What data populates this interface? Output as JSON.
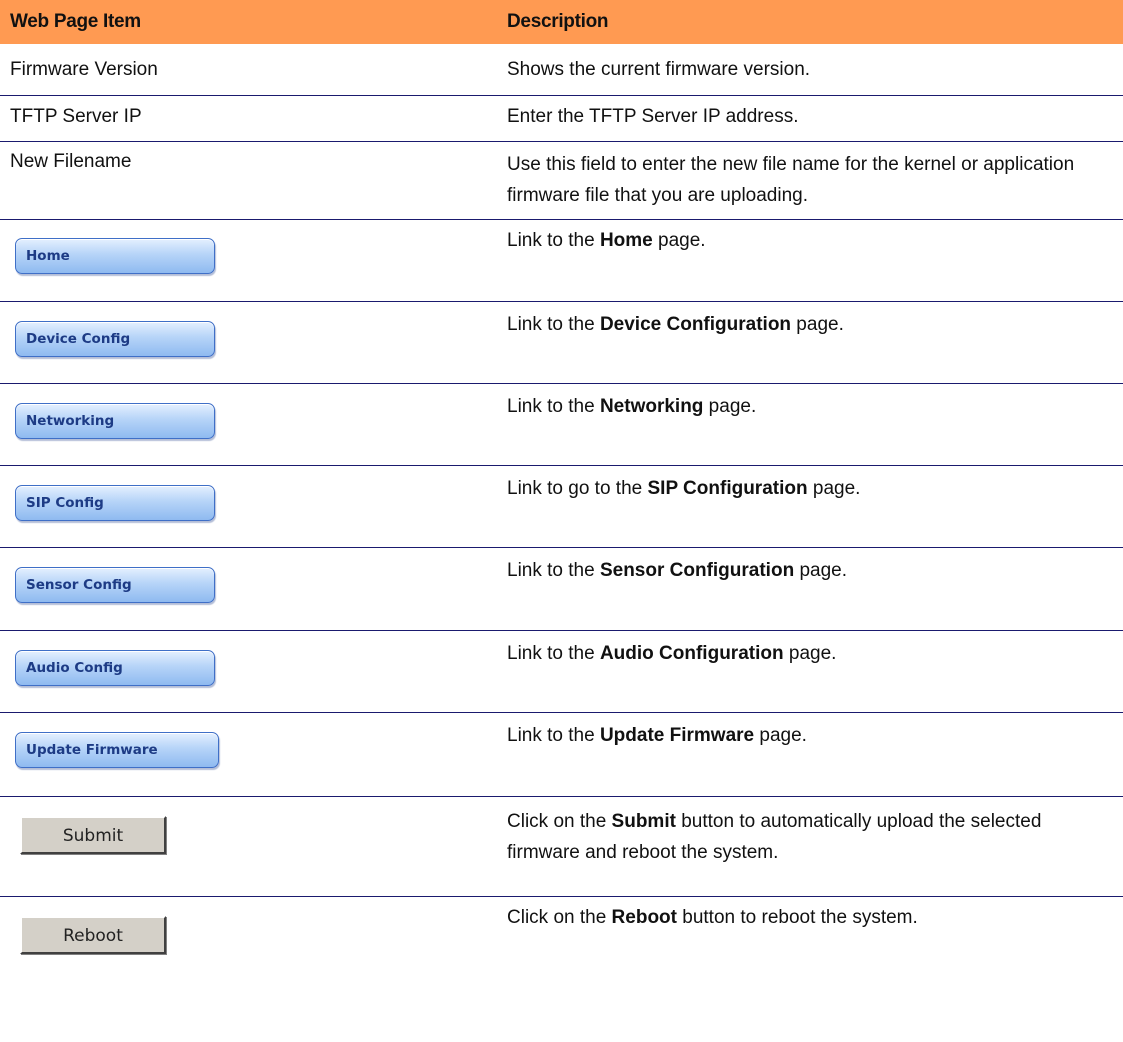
{
  "table": {
    "headers": [
      "Web Page Item",
      "Description"
    ],
    "rows": [
      {
        "item": "Firmware Version",
        "description": "Shows the current firmware version."
      },
      {
        "item": "TFTP Server IP",
        "description": "Enter the TFTP Server IP address."
      },
      {
        "item": "New Filename",
        "description": "Use this field to enter the new file name for the kernel or application firmware file that you are uploading."
      },
      {
        "item_button": "Home",
        "desc_pre": "Link to the ",
        "desc_bold": "Home",
        "desc_post": " page."
      },
      {
        "item_button": "Device Config",
        "desc_pre": "Link to the ",
        "desc_bold": "Device Configuration",
        "desc_post": " page."
      },
      {
        "item_button": "Networking",
        "desc_pre": "Link to the ",
        "desc_bold": "Networking",
        "desc_post": " page."
      },
      {
        "item_button": "SIP Config",
        "desc_pre": "Link to go to the ",
        "desc_bold": "SIP Configuration",
        "desc_post": " page."
      },
      {
        "item_button": "Sensor Config",
        "desc_pre": "Link to the ",
        "desc_bold": "Sensor Configuration",
        "desc_post": " page."
      },
      {
        "item_button": "Audio Config",
        "desc_pre": "Link to the ",
        "desc_bold": "Audio Configuration",
        "desc_post": " page."
      },
      {
        "item_button": "Update Firmware",
        "desc_pre": "Link to the ",
        "desc_bold": "Update Firmware",
        "desc_post": " page."
      },
      {
        "item_button": "Submit",
        "desc_pre": "Click on the ",
        "desc_bold": "Submit",
        "desc_post": " button to automatically upload the selected firmware and reboot the system."
      },
      {
        "item_button": "Reboot",
        "desc_pre": "Click on the ",
        "desc_bold": "Reboot",
        "desc_post": " button to reboot the system."
      }
    ]
  },
  "colors": {
    "header_bg": "#ff9a52",
    "separator": "#1a1a6e",
    "nav_button_text": "#1d3b85"
  }
}
